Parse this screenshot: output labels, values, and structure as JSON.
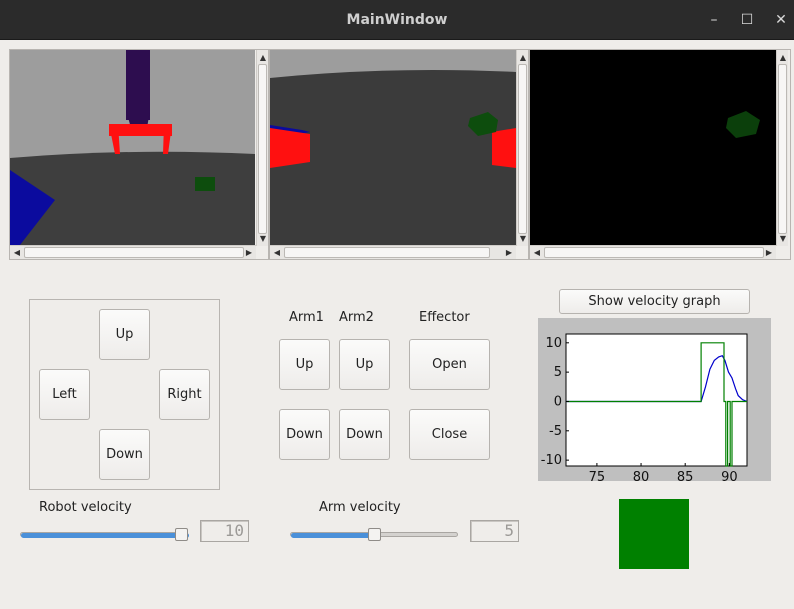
{
  "window": {
    "title": "MainWindow",
    "minimize": "–",
    "maximize": "☐",
    "close": "✕"
  },
  "colors": {
    "status": "#008000",
    "series_velocity": "#0000cc",
    "series_command": "#008000"
  },
  "dpad": {
    "up": "Up",
    "left": "Left",
    "right": "Right",
    "down": "Down"
  },
  "arm": {
    "arm1_label": "Arm1",
    "arm2_label": "Arm2",
    "effector_label": "Effector",
    "arm1_up": "Up",
    "arm1_down": "Down",
    "arm2_up": "Up",
    "arm2_down": "Down",
    "effector_open": "Open",
    "effector_close": "Close"
  },
  "velocity": {
    "robot_label": "Robot velocity",
    "robot_value": "10",
    "robot_fraction": 1.0,
    "arm_label": "Arm velocity",
    "arm_value": "5",
    "arm_fraction": 0.5
  },
  "graph_button": "Show velocity graph",
  "chart_data": {
    "type": "line",
    "title": "",
    "xlabel": "",
    "ylabel": "",
    "xlim": [
      71.5,
      92
    ],
    "ylim": [
      -11,
      11.5
    ],
    "xticks": [
      "75",
      "80",
      "85",
      "90"
    ],
    "yticks": [
      "10",
      "5",
      "0",
      "-5",
      "-10"
    ],
    "grid": false,
    "series": [
      {
        "color": "blue",
        "x": [
          71.5,
          86.8,
          87.3,
          87.8,
          88.3,
          88.8,
          89.2,
          89.5,
          89.9,
          90.3,
          90.7,
          91.0,
          91.5,
          92
        ],
        "y": [
          0,
          0,
          2.5,
          5.5,
          7.0,
          7.6,
          7.8,
          7.0,
          5.0,
          4.0,
          2.2,
          1.0,
          0.3,
          0
        ]
      },
      {
        "color": "green",
        "x": [
          71.5,
          86.8,
          86.8,
          89.4,
          89.4,
          89.6,
          89.6,
          89.8,
          89.8,
          90.1,
          90.1,
          90.3,
          90.3,
          92
        ],
        "y": [
          0,
          0,
          10,
          10,
          0,
          0,
          -11,
          -11,
          0,
          0,
          -11,
          -11,
          0,
          0
        ]
      }
    ]
  }
}
